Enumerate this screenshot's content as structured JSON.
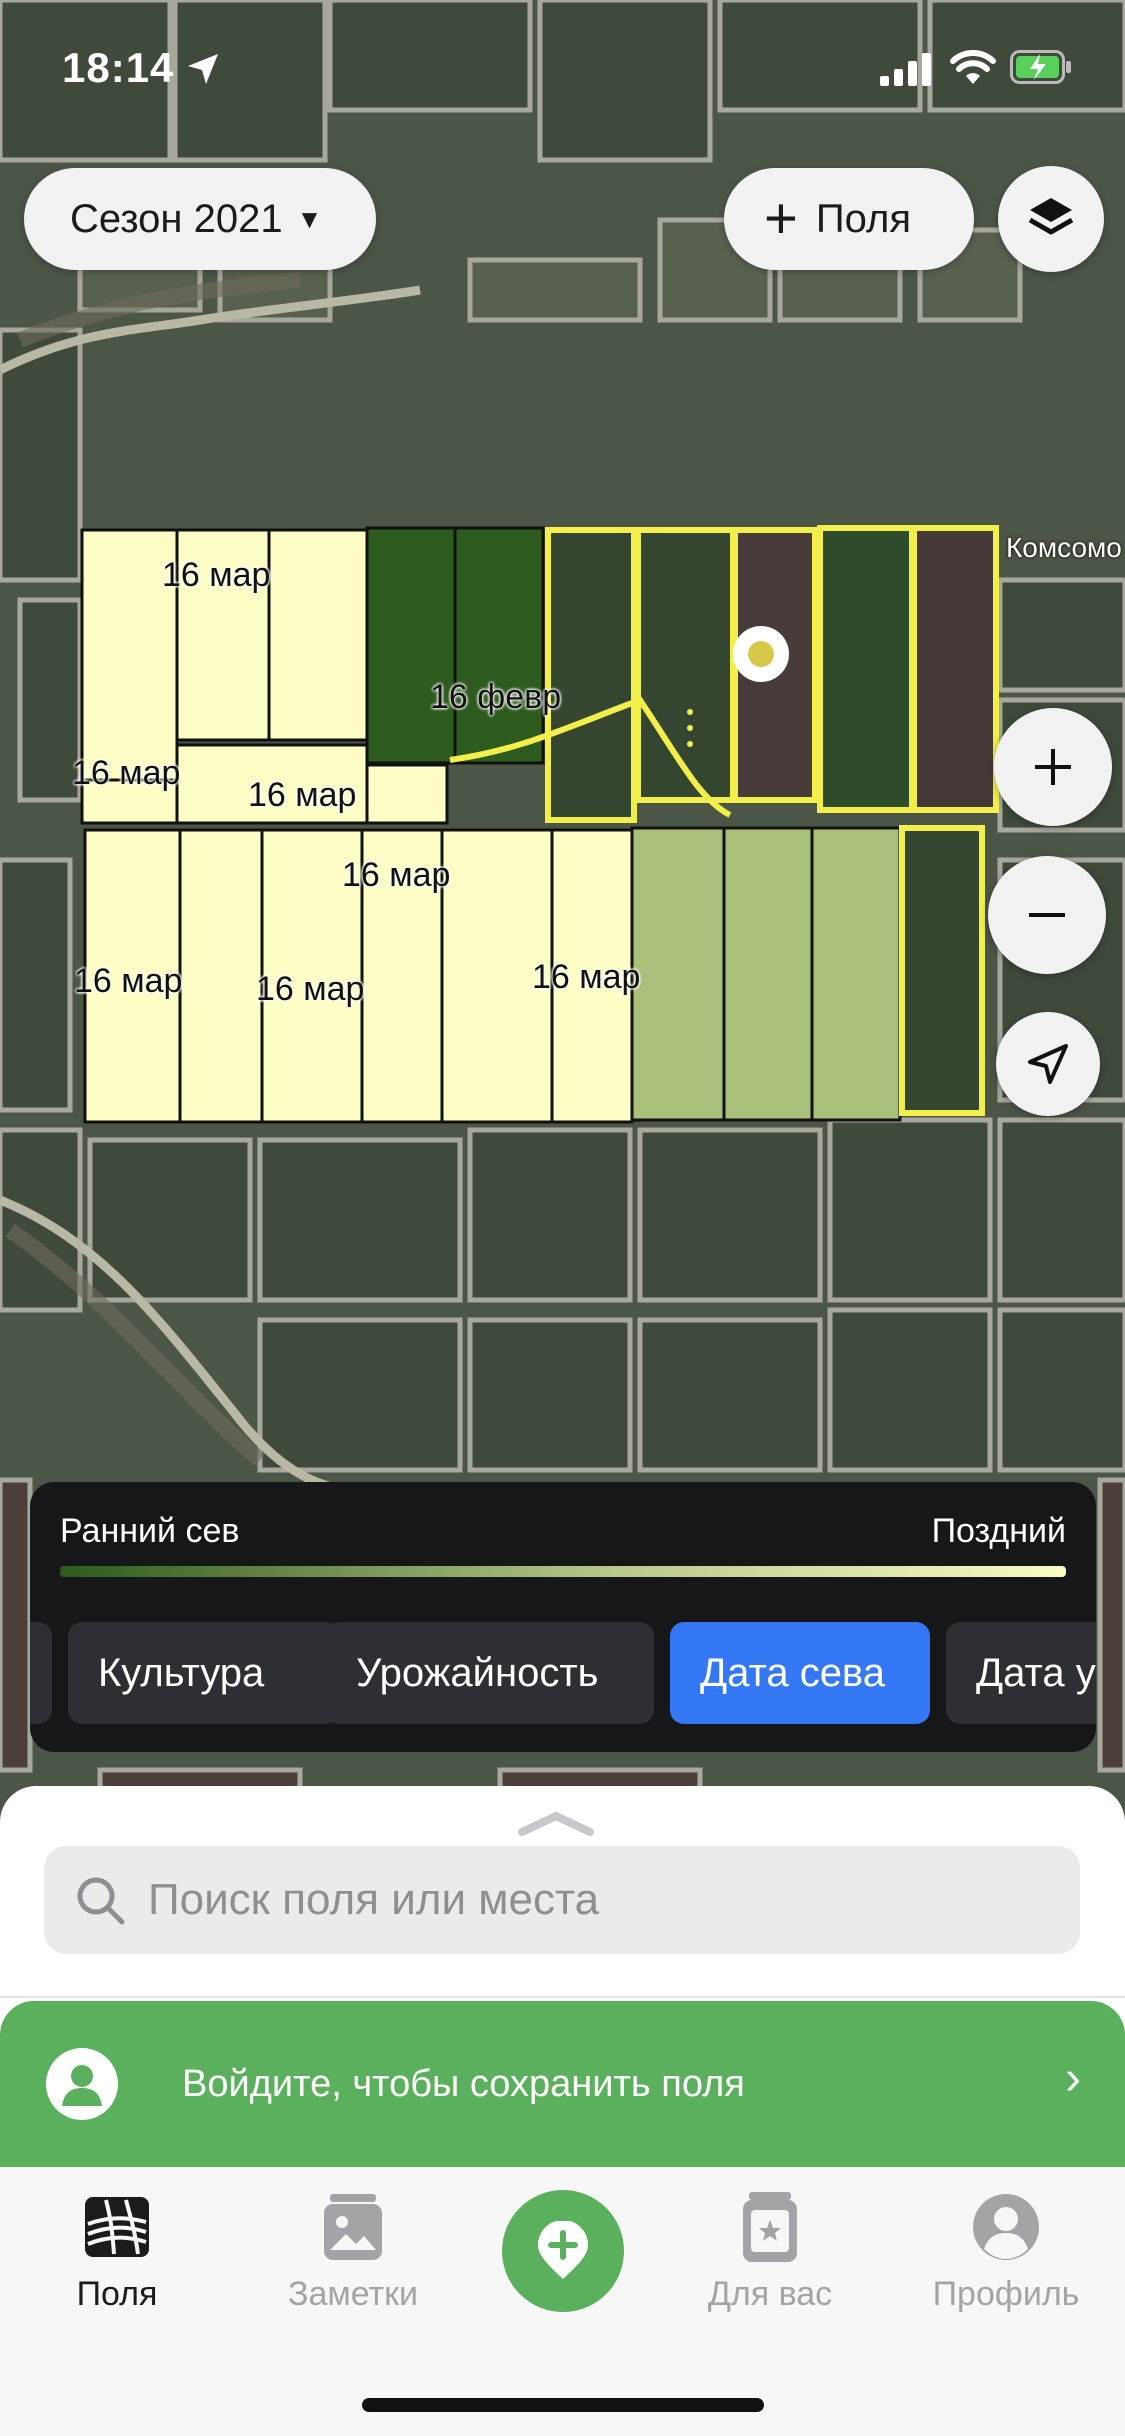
{
  "status_bar": {
    "time": "18:14"
  },
  "season_button": {
    "label": "Сезон 2021"
  },
  "add_fields_button": {
    "label": "Поля"
  },
  "map": {
    "town_label": "Комсомо",
    "field_labels": [
      "16 мар",
      "16 февр",
      "16 мар",
      "16 мар",
      "16 мар",
      "16 мар",
      "16 мар",
      "16 мар"
    ]
  },
  "legend": {
    "early_label": "Ранний сев",
    "late_label": "Поздний",
    "gradient_colors": [
      "#2d5a1d",
      "#b7c98a",
      "#fbfbc4"
    ]
  },
  "layer_chips": [
    "Культура",
    "Урожайность",
    "Дата сева",
    "Дата у"
  ],
  "active_chip": "Дата сева",
  "search": {
    "placeholder": "Поиск поля или места"
  },
  "login_banner": {
    "text": "Войдите, чтобы сохранить поля"
  },
  "tabs": [
    {
      "label": "Поля",
      "icon": "fields-icon",
      "active": true
    },
    {
      "label": "Заметки",
      "icon": "notes-icon",
      "active": false
    },
    {
      "label": "Для вас",
      "icon": "for-you-icon",
      "active": false
    },
    {
      "label": "Профиль",
      "icon": "profile-icon",
      "active": false
    }
  ],
  "colors": {
    "accent_green": "#5bb05d",
    "active_chip_blue": "#3478f6",
    "field_yellow_outline": "#f2ef4a",
    "field_early": "#2d5a1d",
    "field_mid": "#a9c07a",
    "field_late": "#fdfdc6"
  }
}
